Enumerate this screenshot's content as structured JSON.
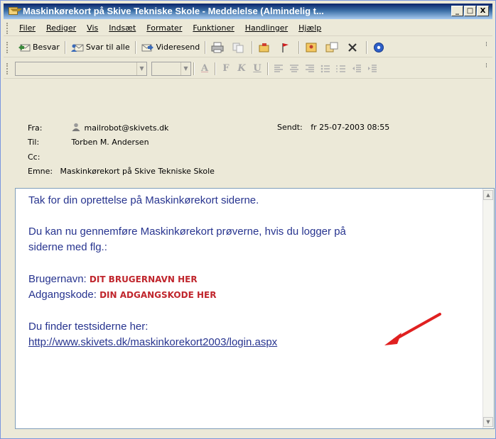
{
  "window": {
    "title": "Maskinkørekort på Skive Tekniske Skole - Meddelelse (Almindelig t...",
    "controls": [
      "_",
      "□",
      "X"
    ]
  },
  "menu": [
    "Filer",
    "Rediger",
    "Vis",
    "Indsæt",
    "Formater",
    "Funktioner",
    "Handlinger",
    "Hjælp"
  ],
  "toolbar": {
    "reply": "Besvar",
    "reply_all": "Svar til alle",
    "forward": "Videresend"
  },
  "format_toolbar": {
    "buttons": [
      "A",
      "F",
      "K",
      "U"
    ]
  },
  "header": {
    "from_label": "Fra:",
    "from_value": "mailrobot@skivets.dk",
    "to_label": "Til:",
    "to_value": "Torben M. Andersen",
    "cc_label": "Cc:",
    "subject_label": "Emne:",
    "subject_value": "Maskinkørekort på Skive Tekniske Skole",
    "sent_label": "Sendt:",
    "sent_value": "fr 25-07-2003 08:55"
  },
  "message": {
    "line1": "Tak for din oprettelse på Maskinkørekort siderne.",
    "line2": "Du kan nu gennemføre Maskinkørekort prøverne, hvis du logger på",
    "line3": "siderne med flg.:",
    "username_label": "Brugernavn:",
    "username_value": "DIT BRUGERNAVN HER",
    "password_label": "Adgangskode:",
    "password_value": "DIN ADGANGSKODE HER",
    "line4": "Du finder testsiderne her:",
    "link": "http://www.skivets.dk/maskinkorekort2003/login.aspx"
  },
  "colors": {
    "message_text": "#27348f",
    "placeholder_red": "#c0262d",
    "arrow_red": "#e02020"
  }
}
